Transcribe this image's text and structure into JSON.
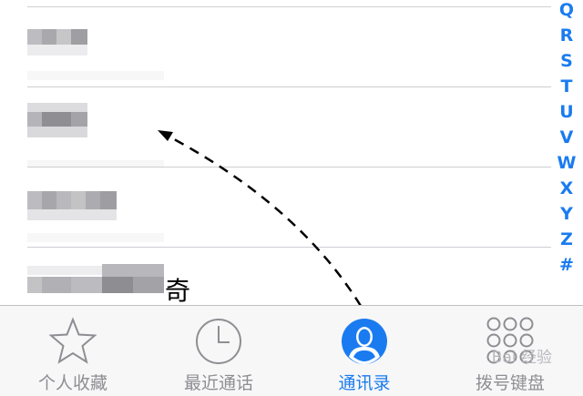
{
  "contact_list": {
    "visible_name_char": "奇"
  },
  "index_bar": {
    "letters": [
      "Q",
      "R",
      "S",
      "T",
      "U",
      "V",
      "W",
      "X",
      "Y",
      "Z",
      "#"
    ]
  },
  "tabbar": {
    "tabs": [
      {
        "label": "个人收藏",
        "icon": "star-icon",
        "active": false
      },
      {
        "label": "最近通话",
        "icon": "clock-icon",
        "active": false
      },
      {
        "label": "通讯录",
        "icon": "contacts-icon",
        "active": true
      },
      {
        "label": "拨号键盘",
        "icon": "keypad-icon",
        "active": false
      }
    ],
    "watermark": "Bai 经验"
  },
  "colors": {
    "accent": "#1a7bf0",
    "inactive": "#8e8e93",
    "separator": "#cfcfd4"
  }
}
